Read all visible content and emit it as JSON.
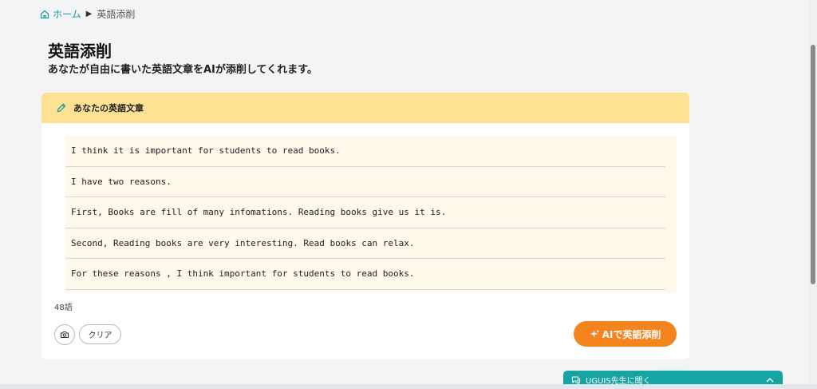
{
  "breadcrumb": {
    "home_label": "ホーム",
    "current_label": "英語添削"
  },
  "page": {
    "title": "英語添削",
    "subtitle": "あなたが自由に書いた英語文章をAIが添削してくれます。"
  },
  "card": {
    "header_label": "あなたの英語文章",
    "lines": [
      "I think it is important for students to read books.",
      "I have two reasons.",
      "First, Books are fill of many infomations. Reading books give us it is.",
      "Second, Reading books are very interesting. Read books can relax.",
      "For these reasons , I think important for students to read books."
    ],
    "word_count": "48語",
    "clear_label": "クリア",
    "ai_button_label": "AIで英語添削",
    "ai_button_icon": "sparkles-icon"
  },
  "chat": {
    "label": "UGUIS先生に聞く"
  },
  "colors": {
    "accent_teal": "#1a9aa8",
    "header_yellow": "#fde293",
    "button_orange": "#f5841f"
  }
}
